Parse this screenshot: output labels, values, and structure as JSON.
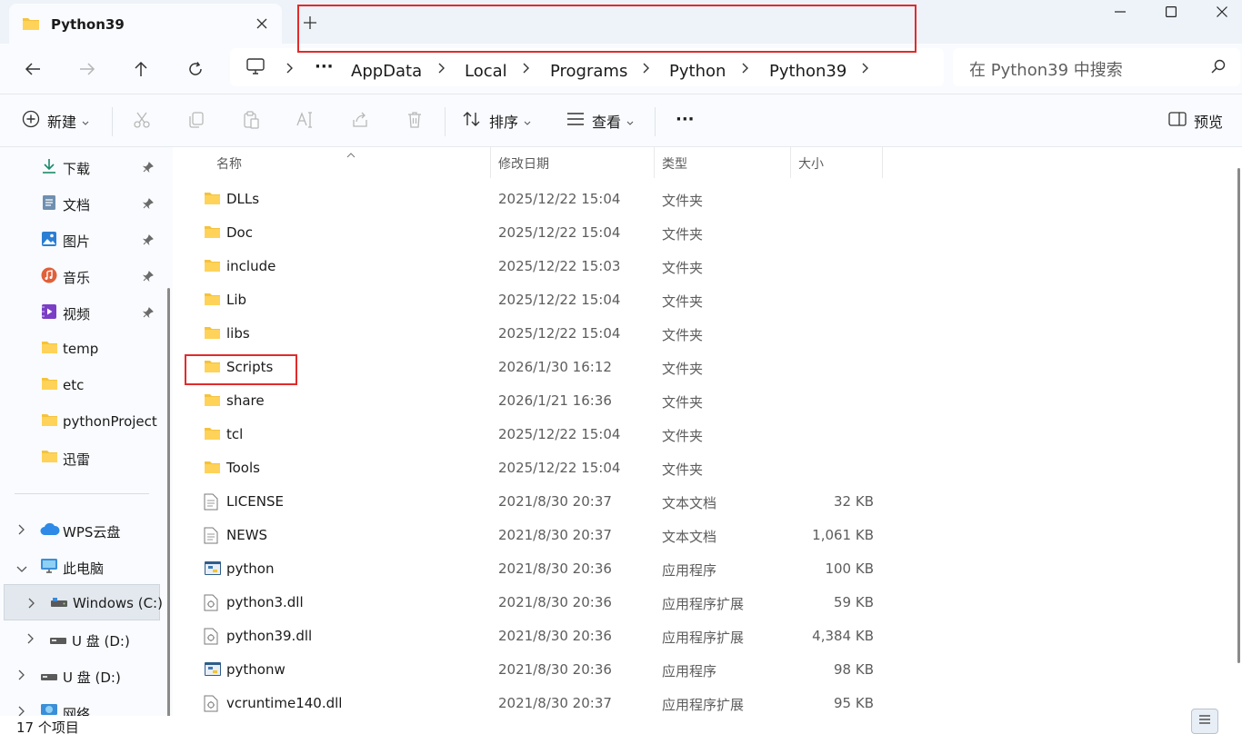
{
  "window": {
    "tab_title": "Python39",
    "tab_close_icon": "close-icon",
    "new_tab_icon": "plus-icon"
  },
  "nav": {
    "back": "arrow-left-icon",
    "forward": "arrow-right-icon",
    "up": "arrow-up-icon",
    "refresh": "refresh-icon",
    "ellipsis": "···",
    "breadcrumbs": [
      "AppData",
      "Local",
      "Programs",
      "Python",
      "Python39"
    ],
    "search_placeholder": "在 Python39 中搜索"
  },
  "commands": {
    "new_label": "新建",
    "sort_label": "排序",
    "view_label": "查看",
    "more_label": "···",
    "preview_label": "预览"
  },
  "sidebar": {
    "quick_access": [
      {
        "label": "下载",
        "icon": "download-icon",
        "pinned": true
      },
      {
        "label": "文档",
        "icon": "document-icon",
        "pinned": true
      },
      {
        "label": "图片",
        "icon": "picture-icon",
        "pinned": true
      },
      {
        "label": "音乐",
        "icon": "music-icon",
        "pinned": true
      },
      {
        "label": "视频",
        "icon": "video-icon",
        "pinned": true
      },
      {
        "label": "temp",
        "icon": "folder-icon",
        "pinned": false
      },
      {
        "label": "etc",
        "icon": "folder-icon",
        "pinned": false
      },
      {
        "label": "pythonProject",
        "icon": "folder-icon",
        "pinned": false
      },
      {
        "label": "迅雷",
        "icon": "folder-icon",
        "pinned": false
      }
    ],
    "wps": "WPS云盘",
    "this_pc": "此电脑",
    "windows_drive": "Windows (C:)",
    "usb_drive_1": "U 盘 (D:)",
    "usb_drive_2": "U 盘 (D:)",
    "network": "网络"
  },
  "list": {
    "headers": {
      "name": "名称",
      "date": "修改日期",
      "type": "类型",
      "size": "大小"
    },
    "rows": [
      {
        "name": "DLLs",
        "date": "2025/12/22 15:04",
        "type": "文件夹",
        "size": "",
        "icon": "folder-icon"
      },
      {
        "name": "Doc",
        "date": "2025/12/22 15:04",
        "type": "文件夹",
        "size": "",
        "icon": "folder-icon"
      },
      {
        "name": "include",
        "date": "2025/12/22 15:03",
        "type": "文件夹",
        "size": "",
        "icon": "folder-icon"
      },
      {
        "name": "Lib",
        "date": "2025/12/22 15:04",
        "type": "文件夹",
        "size": "",
        "icon": "folder-icon"
      },
      {
        "name": "libs",
        "date": "2025/12/22 15:04",
        "type": "文件夹",
        "size": "",
        "icon": "folder-icon"
      },
      {
        "name": "Scripts",
        "date": "2026/1/30 16:12",
        "type": "文件夹",
        "size": "",
        "icon": "folder-icon"
      },
      {
        "name": "share",
        "date": "2026/1/21 16:36",
        "type": "文件夹",
        "size": "",
        "icon": "folder-icon"
      },
      {
        "name": "tcl",
        "date": "2025/12/22 15:04",
        "type": "文件夹",
        "size": "",
        "icon": "folder-icon"
      },
      {
        "name": "Tools",
        "date": "2025/12/22 15:04",
        "type": "文件夹",
        "size": "",
        "icon": "folder-icon"
      },
      {
        "name": "LICENSE",
        "date": "2021/8/30 20:37",
        "type": "文本文档",
        "size": "32 KB",
        "icon": "text-file-icon"
      },
      {
        "name": "NEWS",
        "date": "2021/8/30 20:37",
        "type": "文本文档",
        "size": "1,061 KB",
        "icon": "text-file-icon"
      },
      {
        "name": "python",
        "date": "2021/8/30 20:36",
        "type": "应用程序",
        "size": "100 KB",
        "icon": "python-app-icon"
      },
      {
        "name": "python3.dll",
        "date": "2021/8/30 20:36",
        "type": "应用程序扩展",
        "size": "59 KB",
        "icon": "dll-file-icon"
      },
      {
        "name": "python39.dll",
        "date": "2021/8/30 20:36",
        "type": "应用程序扩展",
        "size": "4,384 KB",
        "icon": "dll-file-icon"
      },
      {
        "name": "pythonw",
        "date": "2021/8/30 20:36",
        "type": "应用程序",
        "size": "98 KB",
        "icon": "python-app-icon"
      },
      {
        "name": "vcruntime140.dll",
        "date": "2021/8/30 20:37",
        "type": "应用程序扩展",
        "size": "95 KB",
        "icon": "dll-file-icon"
      }
    ]
  },
  "status": {
    "count": "17 个项目"
  },
  "colors": {
    "folder": "#f5c33b",
    "highlight": "#e12b2b",
    "accent": "#005fb8"
  }
}
